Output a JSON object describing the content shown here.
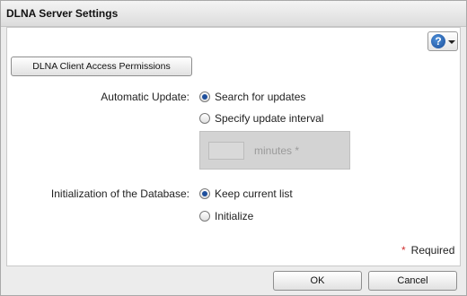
{
  "window": {
    "title": "DLNA Server Settings"
  },
  "toolbar": {
    "help_icon": "question-mark-icon",
    "help_glyph": "?",
    "access_button_label": "DLNA Client Access Permissions"
  },
  "automatic_update": {
    "label": "Automatic Update:",
    "options": [
      {
        "label": "Search for updates",
        "selected": true
      },
      {
        "label": "Specify update interval",
        "selected": false
      }
    ],
    "interval": {
      "value": "",
      "unit": "minutes",
      "required_mark": "*",
      "disabled": true
    }
  },
  "database_init": {
    "label": "Initialization of the Database:",
    "options": [
      {
        "label": "Keep current list",
        "selected": true
      },
      {
        "label": "Initialize",
        "selected": false
      }
    ]
  },
  "footer": {
    "required_star": "*",
    "required_text": "Required",
    "ok_label": "OK",
    "cancel_label": "Cancel"
  },
  "colors": {
    "accent": "#1e4f9c",
    "required_star": "#d03030"
  }
}
